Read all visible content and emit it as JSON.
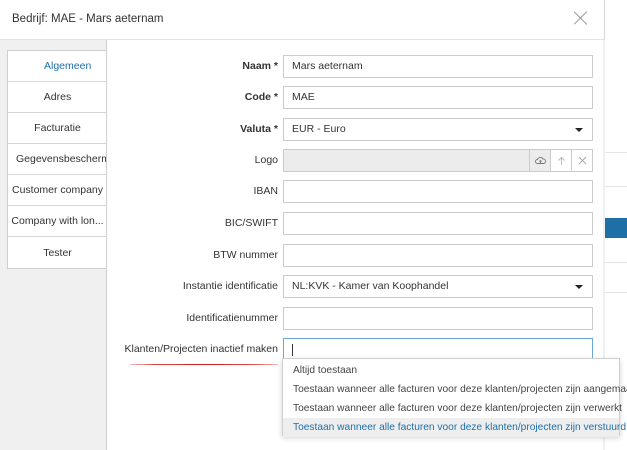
{
  "dialog": {
    "title": "Bedrijf: MAE - Mars aeternam"
  },
  "tabs": [
    {
      "label": "Algemeen",
      "active": true
    },
    {
      "label": "Adres"
    },
    {
      "label": "Facturatie"
    },
    {
      "label": "Gegevensbescherming"
    },
    {
      "label": "Customer company"
    },
    {
      "label": "Company with lon..."
    },
    {
      "label": "Tester"
    }
  ],
  "form": {
    "naam": {
      "label": "Naam *",
      "value": "Mars aeternam"
    },
    "code": {
      "label": "Code *",
      "value": "MAE"
    },
    "valuta": {
      "label": "Valuta *",
      "value": "EUR - Euro"
    },
    "logo": {
      "label": "Logo",
      "value": ""
    },
    "iban": {
      "label": "IBAN",
      "value": ""
    },
    "bic": {
      "label": "BIC/SWIFT",
      "value": ""
    },
    "btw": {
      "label": "BTW nummer",
      "value": ""
    },
    "instantie": {
      "label": "Instantie identificatie",
      "value": "NL:KVK - Kamer van Koophandel"
    },
    "identificatienummer": {
      "label": "Identificatienummer",
      "value": ""
    },
    "klanten": {
      "label": "Klanten/Projecten inactief maken",
      "value": ""
    }
  },
  "dropdown": {
    "options": [
      "Altijd toestaan",
      "Toestaan wanneer alle facturen voor deze klanten/projecten zijn aangemaakt",
      "Toestaan wanneer alle facturen voor deze klanten/projecten zijn verwerkt",
      "Toestaan wanneer alle facturen voor deze klanten/projecten zijn verstuurd"
    ],
    "highlighted_index": 3
  },
  "colors": {
    "accent": "#1f6fa8",
    "annotation": "#d62020"
  }
}
